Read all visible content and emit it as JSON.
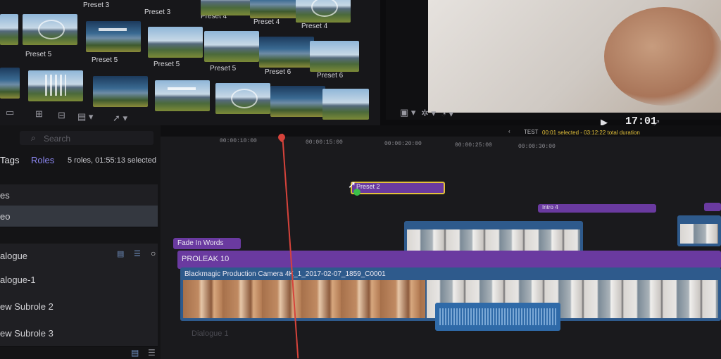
{
  "browser": {
    "row_labels_top": [
      "Preset 3",
      "Preset 3",
      "Preset 4",
      "Preset 4",
      "Preset 4"
    ],
    "row_labels_middle": [
      "Preset 5",
      "Preset 5",
      "Preset 5",
      "Preset 5",
      "Preset 6",
      "Preset 6"
    ]
  },
  "viewer": {
    "timecode": "17:01"
  },
  "timeline_header": {
    "project": "TEST",
    "selection": "00:01 selected - 03:12:22 total duration"
  },
  "index": {
    "search_placeholder": "Search",
    "tab_tags": "Tags",
    "tab_roles": "Roles",
    "summary": "5 roles, 01:55:13 selected",
    "roles": [
      "es",
      "eo",
      "alogue",
      "alogue-1",
      "ew Subrole 2",
      "ew Subrole 3"
    ]
  },
  "ruler": {
    "ticks": [
      "00:00:10:00",
      "00:00:15:00",
      "00:00:20:00",
      "00:00:25:00",
      "00:00:30:00"
    ]
  },
  "clips": {
    "preset": "Preset 2",
    "fade": "Fade In Words",
    "proleak": "PROLEAK 10",
    "camera": "Blackmagic Production Camera 4K_1_2017-02-07_1859_C0001",
    "title_right": "Intro 4",
    "dialogue_lane": "Dialogue 1"
  },
  "colors": {
    "accent": "#6a3aa0",
    "selection": "#e3c13a",
    "playhead": "#d6433b",
    "roles_tab": "#8b86f0"
  }
}
